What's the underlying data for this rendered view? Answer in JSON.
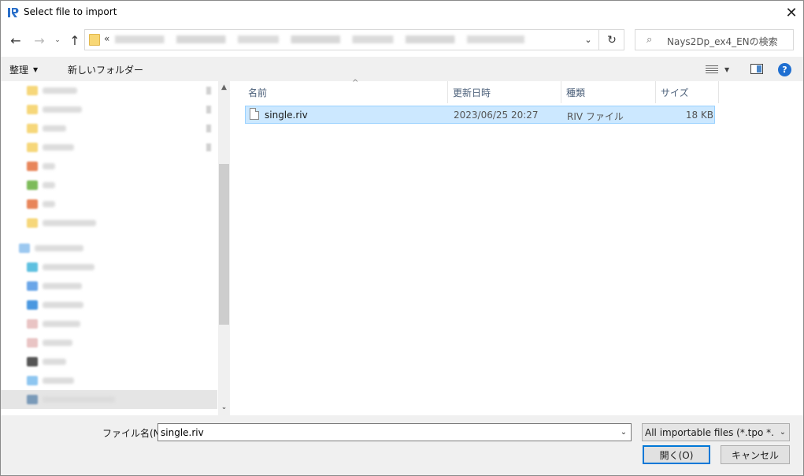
{
  "window": {
    "title": "Select file to import",
    "app_icon": "iric-icon",
    "close_glyph": "✕"
  },
  "nav": {
    "back_glyph": "←",
    "forward_glyph": "→",
    "recent_glyph": "⌄",
    "up_glyph": "↑",
    "address_prefix": "«",
    "refresh_glyph": "↻",
    "dropdown_glyph": "⌄"
  },
  "search": {
    "placeholder": "Nays2Dp_ex4_ENの検索",
    "icon_glyph": "⌕"
  },
  "toolbar": {
    "organize_label": "整理",
    "organize_arrow": "▼",
    "new_folder_label": "新しいフォルダー",
    "view_arrow": "▼",
    "help_glyph": "?"
  },
  "columns": {
    "name": "名前",
    "date": "更新日時",
    "type": "種類",
    "size": "サイズ",
    "sort_glyph": "^"
  },
  "files": [
    {
      "name": "single.riv",
      "date": "2023/06/25 20:27",
      "type": "RIV ファイル",
      "size": "18 KB"
    }
  ],
  "scroll": {
    "up_glyph": "▲",
    "down_glyph": "⌄"
  },
  "bottom": {
    "filename_label": "ファイル名(N):",
    "filename_value": "single.riv",
    "filename_dropdown": "⌄",
    "filter_value": "All importable files (*.tpo *.csv *",
    "filter_dropdown": "⌄",
    "open_label": "開く(O)",
    "cancel_label": "キャンセル"
  },
  "colors": {
    "selection": "#cce8ff",
    "selection_border": "#99d1ff",
    "accent": "#0078d7",
    "help": "#1f6fd1"
  }
}
